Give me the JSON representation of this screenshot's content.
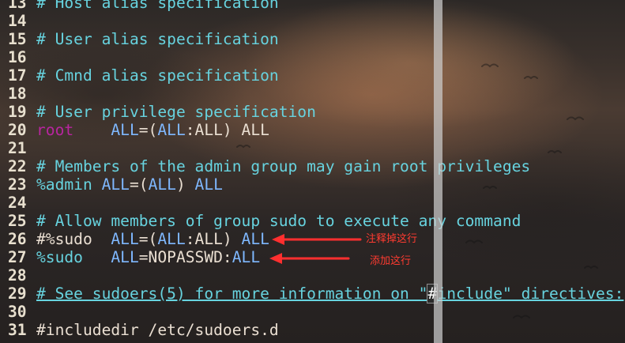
{
  "editor": {
    "lines": [
      {
        "n": "13",
        "segments": [
          {
            "t": "# Host alias specification",
            "c": "comment"
          }
        ]
      },
      {
        "n": "14",
        "segments": []
      },
      {
        "n": "15",
        "segments": [
          {
            "t": "# User alias specification",
            "c": "comment"
          }
        ]
      },
      {
        "n": "16",
        "segments": []
      },
      {
        "n": "17",
        "segments": [
          {
            "t": "# Cmnd alias specification",
            "c": "comment"
          }
        ]
      },
      {
        "n": "18",
        "segments": []
      },
      {
        "n": "19",
        "segments": [
          {
            "t": "# User privilege specification",
            "c": "comment"
          }
        ]
      },
      {
        "n": "20",
        "segments": [
          {
            "t": "root",
            "c": "root"
          },
          {
            "t": "    ",
            "c": "plain"
          },
          {
            "t": "ALL",
            "c": "allword"
          },
          {
            "t": "=(",
            "c": "plain"
          },
          {
            "t": "ALL",
            "c": "allword"
          },
          {
            "t": ":ALL) ALL",
            "c": "plain"
          }
        ]
      },
      {
        "n": "21",
        "segments": []
      },
      {
        "n": "22",
        "segments": [
          {
            "t": "# Members of the admin group may gain root privileges",
            "c": "comment"
          }
        ]
      },
      {
        "n": "23",
        "segments": [
          {
            "t": "%admin",
            "c": "pct"
          },
          {
            "t": " ",
            "c": "plain"
          },
          {
            "t": "ALL",
            "c": "allword"
          },
          {
            "t": "=(",
            "c": "plain"
          },
          {
            "t": "ALL",
            "c": "allword"
          },
          {
            "t": ") ",
            "c": "plain"
          },
          {
            "t": "ALL",
            "c": "allword"
          }
        ]
      },
      {
        "n": "24",
        "segments": []
      },
      {
        "n": "25",
        "segments": [
          {
            "t": "# Allow members of group sudo to execute any command",
            "c": "comment"
          }
        ]
      },
      {
        "n": "26",
        "segments": [
          {
            "t": "#%sudo",
            "c": "plain"
          },
          {
            "t": "  ",
            "c": "plain"
          },
          {
            "t": "ALL",
            "c": "allword"
          },
          {
            "t": "=(",
            "c": "plain"
          },
          {
            "t": "ALL",
            "c": "allword"
          },
          {
            "t": ":ALL) ",
            "c": "plain"
          },
          {
            "t": "ALL",
            "c": "allword"
          }
        ]
      },
      {
        "n": "27",
        "segments": [
          {
            "t": "%sudo",
            "c": "pct"
          },
          {
            "t": "   ",
            "c": "plain"
          },
          {
            "t": "ALL",
            "c": "allword"
          },
          {
            "t": "=NOPASSWD:",
            "c": "nopass"
          },
          {
            "t": "ALL",
            "c": "allword"
          }
        ]
      },
      {
        "n": "28",
        "segments": []
      },
      {
        "n": "29",
        "segments": [
          {
            "t": "# See sudoers(5) for more information on \"",
            "c": "comment underline"
          },
          {
            "t": "#",
            "c": "cursor"
          },
          {
            "t": "include\" directives:",
            "c": "comment underline"
          }
        ]
      },
      {
        "n": "30",
        "segments": []
      },
      {
        "n": "31",
        "segments": [
          {
            "t": "#includedir /etc/sudoers.d",
            "c": "plain"
          }
        ]
      }
    ]
  },
  "annotations": {
    "comment_out": "注释掉这行",
    "add_line": "添加这行"
  },
  "colors": {
    "comment": "#67d3df",
    "root": "#b8259f",
    "all_keyword": "#7fb8ff",
    "plain": "#eadfd2",
    "annotation": "#ff3b30",
    "scrollbar": "#cdcdcd"
  },
  "icons": {
    "arrow_1": "left-arrow-icon",
    "arrow_2": "left-arrow-icon"
  }
}
